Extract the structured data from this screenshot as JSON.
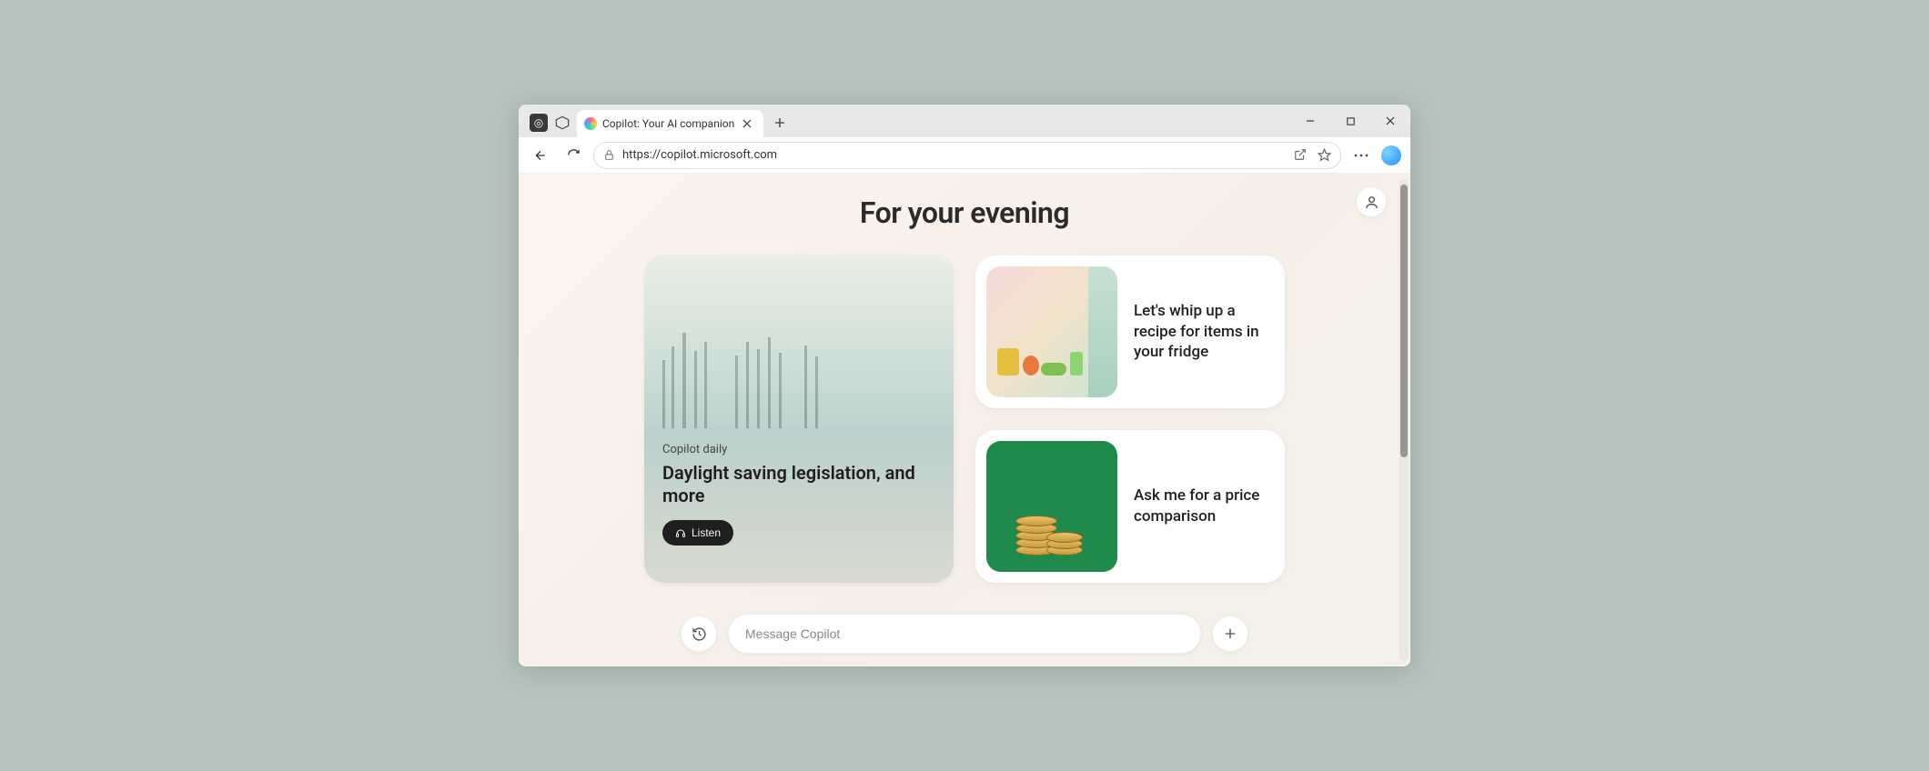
{
  "browser": {
    "tab_title": "Copilot: Your AI companion",
    "url": "https://copilot.microsoft.com"
  },
  "page": {
    "heading": "For your evening"
  },
  "hero": {
    "eyebrow": "Copilot daily",
    "headline": "Daylight saving legislation, and more",
    "listen_label": "Listen"
  },
  "cards": [
    {
      "text": "Let's whip up a recipe for items in your fridge"
    },
    {
      "text": "Ask me for a price comparison"
    }
  ],
  "composer": {
    "placeholder": "Message Copilot"
  }
}
